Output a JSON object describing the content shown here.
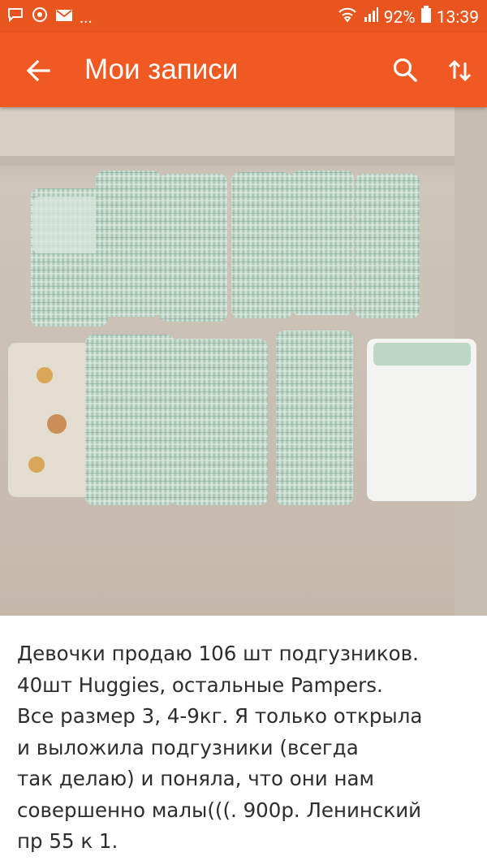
{
  "status_bar": {
    "notification_icons": [
      "chat-bubble-icon",
      "circle-notification-icon",
      "mail-icon"
    ],
    "more_indicator": "...",
    "wifi_icon": "wifi-icon",
    "signal_icon": "signal-icon",
    "battery_percent": "92%",
    "battery_icon": "battery-icon",
    "time": "13:39"
  },
  "app_bar": {
    "title": "Мои записи",
    "back_icon": "back-arrow-icon",
    "search_icon": "search-icon",
    "sort_icon": "sort-icon",
    "color": "#f05a22"
  },
  "post": {
    "photo_description_icon": "photo-diaper-packs",
    "text_lines": [
      "Девочки продаю 106 шт подгузников.",
      "40шт Huggies, остальные Pampers.",
      "Все размер 3, 4-9кг. Я только открыла",
      "и выложила подгузники (всегда",
      "так делаю) и поняла, что они нам",
      "совершенно малы(((. 900р. Ленинский",
      "пр 55 к 1."
    ]
  }
}
